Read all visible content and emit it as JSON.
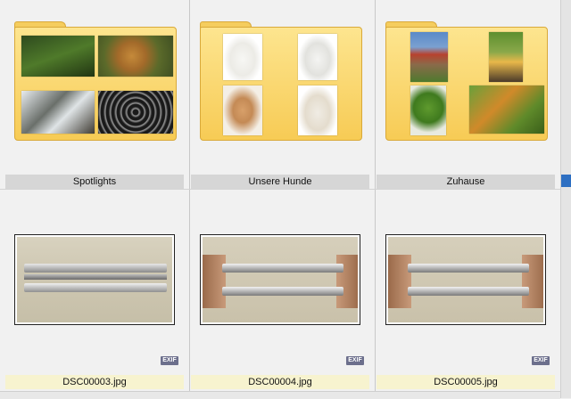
{
  "folders": [
    {
      "name": "Spotlights"
    },
    {
      "name": "Unsere Hunde"
    },
    {
      "name": "Zuhause"
    }
  ],
  "files": [
    {
      "name": "DSC00003.jpg",
      "badge": "EXIF"
    },
    {
      "name": "DSC00004.jpg",
      "badge": "EXIF"
    },
    {
      "name": "DSC00005.jpg",
      "badge": "EXIF"
    }
  ],
  "colors": {
    "folder_yellow": "#f7cb55",
    "selected_label": "#f7f3cf",
    "scroll_accent": "#2d6fc2"
  }
}
